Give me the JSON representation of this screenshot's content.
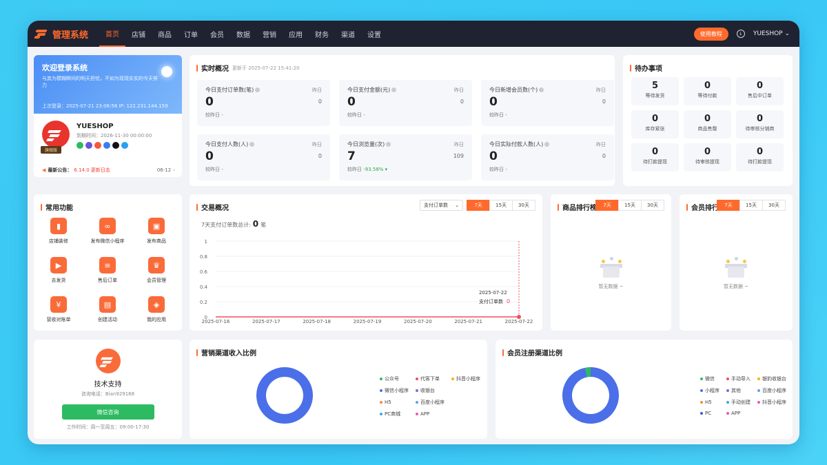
{
  "app": {
    "title": "管理系统",
    "user": "YUESHOP",
    "tutorial": "使用教程"
  },
  "nav": [
    "首页",
    "店铺",
    "商品",
    "订单",
    "会员",
    "数据",
    "营销",
    "应用",
    "财务",
    "渠道",
    "设置"
  ],
  "welcome": {
    "title": "欢迎登录系统",
    "slogan": "与其为模糊瞬间的明天担忧，不如为现现实实的今天努力",
    "last_login": "上次登录：2025-07-21 23:06:56 IP: 122.231.144.159",
    "shop_name": "YUESHOP",
    "expire": "到期时间：2026-11-30 00:00:00",
    "edition": "旗舰版",
    "notice_label": "最新公告：",
    "notice_text": "6.14.0 更新日志",
    "notice_date": "06-12"
  },
  "realtime": {
    "title": "实时概况",
    "updated": "更新于 2025-07-22 15:41:20",
    "stats": [
      {
        "label": "今日支付订单数(笔)",
        "value": "0",
        "yday_label": "昨日",
        "yday": "0",
        "cmp": "较昨日 -"
      },
      {
        "label": "今日支付金额(元)",
        "value": "0",
        "yday_label": "昨日",
        "yday": "0",
        "cmp": "较昨日 -"
      },
      {
        "label": "今日新增会员数(个)",
        "value": "0",
        "yday_label": "昨日",
        "yday": "0",
        "cmp": "较昨日 -"
      },
      {
        "label": "今日支付人数(人)",
        "value": "0",
        "yday_label": "昨日",
        "yday": "0",
        "cmp": "较昨日 -"
      },
      {
        "label": "今日浏览量(次)",
        "value": "7",
        "yday_label": "昨日",
        "yday": "109",
        "cmp": "较昨日 ",
        "cmp_green": "-93.58% ▾"
      },
      {
        "label": "今日实际付款人数(人)",
        "value": "0",
        "yday_label": "昨日",
        "yday": "0",
        "cmp": "较昨日 -"
      }
    ]
  },
  "todo": {
    "title": "待办事项",
    "items": [
      {
        "value": "5",
        "label": "等待发货"
      },
      {
        "value": "0",
        "label": "等待付款"
      },
      {
        "value": "0",
        "label": "售后中订单"
      },
      {
        "value": "0",
        "label": "库存紧张"
      },
      {
        "value": "0",
        "label": "商品售罄"
      },
      {
        "value": "0",
        "label": "待审核分销商"
      },
      {
        "value": "0",
        "label": "待打款提现"
      },
      {
        "value": "0",
        "label": "待审核提现"
      },
      {
        "value": "0",
        "label": "待打款提现"
      }
    ]
  },
  "common": {
    "title": "常用功能",
    "items": [
      {
        "label": "店铺装修",
        "icon": "brush-icon"
      },
      {
        "label": "发布微信小程序",
        "icon": "link-icon"
      },
      {
        "label": "发布商品",
        "icon": "goods-icon"
      },
      {
        "label": "去发货",
        "icon": "truck-icon"
      },
      {
        "label": "售后订单",
        "icon": "receipt-icon"
      },
      {
        "label": "会员管理",
        "icon": "crown-icon"
      },
      {
        "label": "营收对账单",
        "icon": "yuan-icon"
      },
      {
        "label": "创建活动",
        "icon": "ticket-icon"
      },
      {
        "label": "我的应用",
        "icon": "cube-icon"
      }
    ]
  },
  "trade": {
    "title": "交易概况",
    "select": "支付订单数",
    "ranges": [
      "7天",
      "15天",
      "30天"
    ],
    "sum_label": "7天支付订单数总计:",
    "sum_value": "0",
    "sum_unit": "笔",
    "tooltip": {
      "date": "2025-07-22",
      "label": "支付订单数",
      "value": "0"
    }
  },
  "chart_data": {
    "type": "line",
    "x": [
      "2025-07-16",
      "2025-07-17",
      "2025-07-18",
      "2025-07-19",
      "2025-07-20",
      "2025-07-21",
      "2025-07-22"
    ],
    "series": [
      {
        "name": "支付订单数",
        "values": [
          0,
          0,
          0,
          0,
          0,
          0,
          0
        ]
      }
    ],
    "yticks": [
      "0",
      "0.2",
      "0.4",
      "0.6",
      "0.8",
      "1"
    ],
    "ylim": [
      0,
      1
    ],
    "color": "#f04e5e"
  },
  "goods_rank": {
    "title": "商品排行榜",
    "ranges": [
      "7天",
      "15天",
      "30天"
    ],
    "empty": "暂无数据 ~"
  },
  "member_rank": {
    "title": "会员排行",
    "ranges": [
      "7天",
      "15天",
      "30天"
    ],
    "empty": "暂无数据 ~"
  },
  "support": {
    "title": "技术支持",
    "phone": "咨询电话：Bian929168",
    "button": "微信咨询",
    "hours": "工作时间：周一至周五：09:00-17:30"
  },
  "marketing_pie": {
    "title": "营销渠道收入比例",
    "legend": [
      {
        "name": "公众号",
        "color": "#2dbb62"
      },
      {
        "name": "代客下单",
        "color": "#f04e5e"
      },
      {
        "name": "抖音小程序",
        "color": "#f5b400"
      },
      {
        "name": "微信小程序",
        "color": "#4b6fe8"
      },
      {
        "name": "收银台",
        "color": "#8a63d2"
      },
      {
        "name": "",
        "color": ""
      },
      {
        "name": "H5",
        "color": "#fa8c35"
      },
      {
        "name": "百度小程序",
        "color": "#5aa1f0"
      },
      {
        "name": "",
        "color": ""
      },
      {
        "name": "PC商城",
        "color": "#3aa8f0"
      },
      {
        "name": "APP",
        "color": "#e85ab0"
      },
      {
        "name": "",
        "color": ""
      }
    ]
  },
  "member_pie": {
    "title": "会员注册渠道比例",
    "legend": [
      {
        "name": "微信",
        "color": "#2dbb62"
      },
      {
        "name": "手动导入",
        "color": "#f04e5e"
      },
      {
        "name": "银豹收银台",
        "color": "#f5b400"
      },
      {
        "name": "小程序",
        "color": "#4b6fe8"
      },
      {
        "name": "其他",
        "color": "#8a63d2"
      },
      {
        "name": "百度小程序",
        "color": "#5aa1f0"
      },
      {
        "name": "H5",
        "color": "#fa8c35"
      },
      {
        "name": "手动创建",
        "color": "#3aa8f0"
      },
      {
        "name": "抖音小程序",
        "color": "#e85ab0"
      },
      {
        "name": "PC",
        "color": "#3a5ad0"
      },
      {
        "name": "APP",
        "color": "#e85ab0"
      },
      {
        "name": "",
        "color": ""
      }
    ]
  },
  "pie_values": {
    "marketing": [
      {
        "name": "微信小程序",
        "share": 1
      }
    ],
    "member": [
      {
        "name": "小程序",
        "share": 0.97
      },
      {
        "name": "微信",
        "share": 0.03
      }
    ]
  }
}
